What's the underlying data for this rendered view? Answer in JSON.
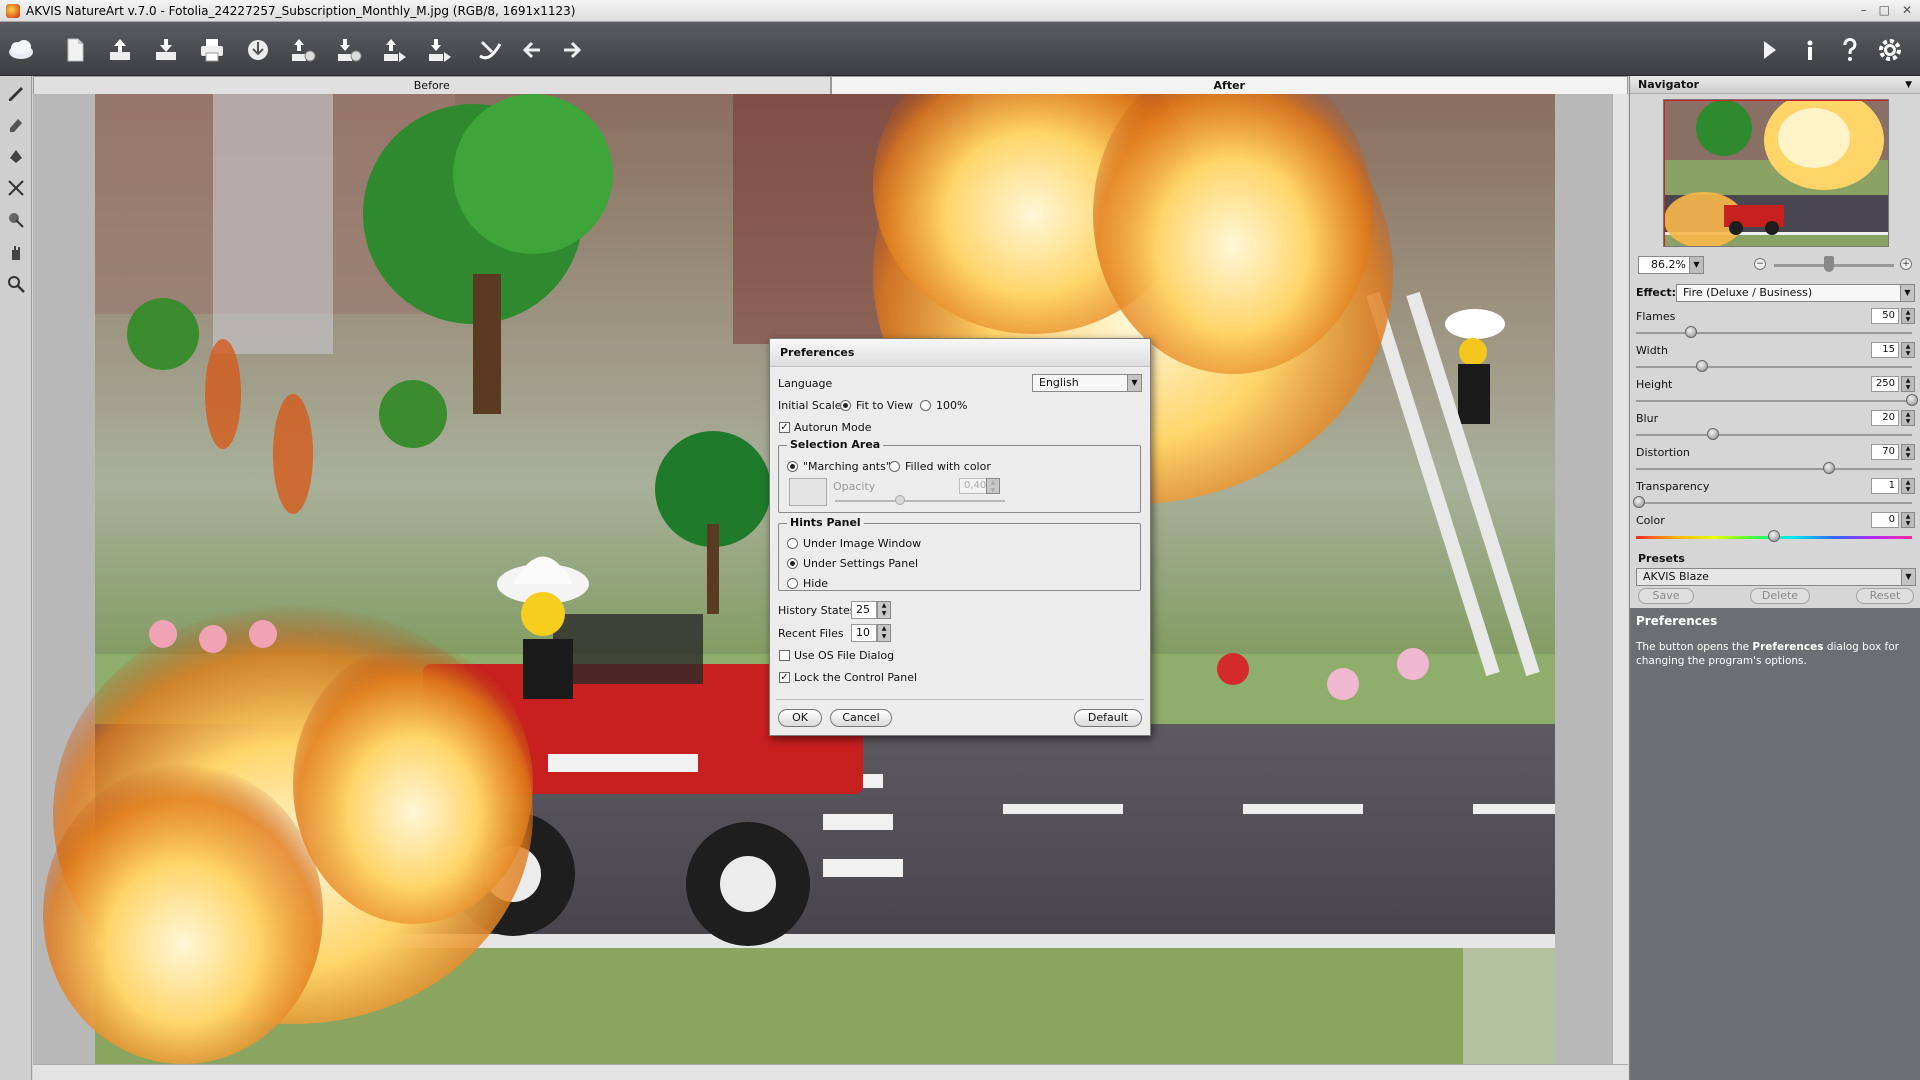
{
  "window": {
    "title": "AKVIS NatureArt v.7.0 - Fotolia_24227257_Subscription_Monthly_M.jpg (RGB/8, 1691x1123)",
    "controls": [
      "–",
      "□",
      "✕"
    ]
  },
  "toolbar": {
    "left_icons": [
      "cloud-logo-icon",
      "new-file-icon",
      "open-icon",
      "save-icon",
      "print-icon",
      "batch-icon",
      "import-settings-icon",
      "export-settings-icon",
      "share-upload-icon",
      "share-download-icon",
      "brush-icon",
      "undo-icon",
      "redo-icon"
    ],
    "right_icons": [
      "run-icon",
      "info-icon",
      "help-icon",
      "preferences-gear-icon"
    ]
  },
  "left_tools": [
    "direction-tool-icon",
    "eraser-tool-icon",
    "fill-tool-icon",
    "crop-tool-icon",
    "history-brush-icon",
    "hand-tool-icon",
    "zoom-tool-icon"
  ],
  "tabs": {
    "before": "Before",
    "after": "After"
  },
  "navigator": {
    "title": "Navigator",
    "zoom": "86.2%"
  },
  "effect": {
    "label": "Effect:",
    "value": "Fire  (Deluxe / Business)"
  },
  "params": [
    {
      "label": "Flames",
      "value": "50",
      "level": 0.2
    },
    {
      "label": "Width",
      "value": "15",
      "level": 0.24
    },
    {
      "label": "Height",
      "value": "250",
      "level": 1.0
    },
    {
      "label": "Blur",
      "value": "20",
      "level": 0.28
    },
    {
      "label": "Distortion",
      "value": "70",
      "level": 0.7
    },
    {
      "label": "Transparency",
      "value": "1",
      "level": 0.01
    },
    {
      "label": "Color",
      "value": "0",
      "level": 0.5
    }
  ],
  "presets": {
    "title": "Presets",
    "value": "AKVIS Blaze",
    "save": "Save",
    "delete": "Delete",
    "reset": "Reset"
  },
  "hints": {
    "title": "Preferences",
    "text_pre": "The button opens the ",
    "text_bold": "Preferences",
    "text_post": " dialog box for changing the program's options."
  },
  "dialog": {
    "title": "Preferences",
    "language_label": "Language",
    "language_value": "English",
    "initial_scale_label": "Initial Scale",
    "scale_fit": "Fit to View",
    "scale_100": "100%",
    "autorun": "Autorun Mode",
    "selection_area": {
      "title": "Selection Area",
      "marching": "\"Marching ants\"",
      "filled": "Filled with color",
      "opacity_label": "Opacity",
      "opacity_value": "0,40"
    },
    "hints_panel": {
      "title": "Hints Panel",
      "opt1": "Under Image Window",
      "opt2": "Under Settings Panel",
      "opt3": "Hide"
    },
    "history_label": "History States",
    "history_value": "25",
    "recent_label": "Recent Files",
    "recent_value": "10",
    "use_os_dialog": "Use OS File Dialog",
    "lock_panel": "Lock the Control Panel",
    "ok": "OK",
    "cancel": "Cancel",
    "default": "Default"
  }
}
